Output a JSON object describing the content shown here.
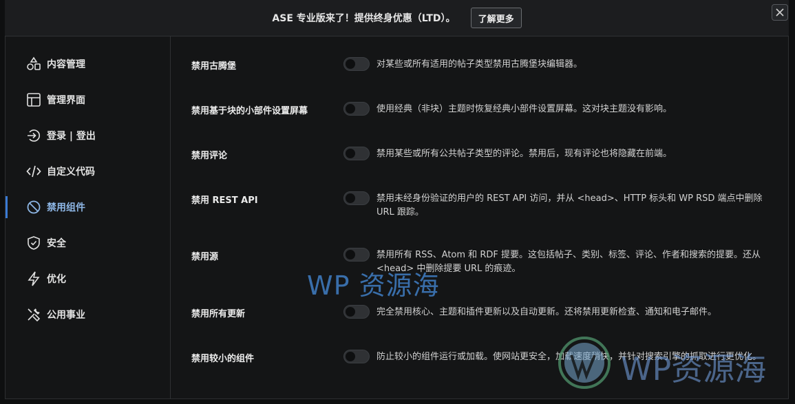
{
  "banner": {
    "text": "ASE 专业版来了！提供终身优惠（LTD）。",
    "button": "了解更多"
  },
  "close_icon": "close-icon",
  "sidebar": {
    "items": [
      {
        "label": "内容管理",
        "icon": "shapes-icon"
      },
      {
        "label": "管理界面",
        "icon": "layout-icon"
      },
      {
        "label": "登录 | 登出",
        "icon": "login-icon"
      },
      {
        "label": "自定义代码",
        "icon": "code-icon"
      },
      {
        "label": "禁用组件",
        "icon": "ban-icon",
        "active": true
      },
      {
        "label": "安全",
        "icon": "shield-icon"
      },
      {
        "label": "优化",
        "icon": "bolt-icon"
      },
      {
        "label": "公用事业",
        "icon": "tools-icon"
      }
    ]
  },
  "settings": [
    {
      "title": "禁用古腾堡",
      "enabled": false,
      "desc": "对某些或所有适用的帖子类型禁用古腾堡块编辑器。"
    },
    {
      "title": "禁用基于块的小部件设置屏幕",
      "enabled": false,
      "desc": "使用经典（非块）主题时恢复经典小部件设置屏幕。这对块主题没有影响。"
    },
    {
      "title": "禁用评论",
      "enabled": false,
      "desc": "禁用某些或所有公共帖子类型的评论。禁用后，现有评论也将隐藏在前端。"
    },
    {
      "title": "禁用 REST API",
      "enabled": false,
      "desc": "禁用未经身份验证的用户的 REST API 访问，并从 <head>、HTTP 标头和 WP RSD 端点中删除 URL 跟踪。"
    },
    {
      "title": "禁用源",
      "enabled": false,
      "desc": "禁用所有 RSS、Atom 和 RDF 提要。这包括帖子、类别、标签、评论、作者和搜索的提要。还从 <head> 中删除提要 URL 的痕迹。"
    },
    {
      "title": "禁用所有更新",
      "enabled": false,
      "desc": "完全禁用核心、主题和插件更新以及自动更新。还将禁用更新检查、通知和电子邮件。"
    },
    {
      "title": "禁用较小的组件",
      "enabled": false,
      "desc": "防止较小的组件运行或加载。使网站更安全，加载速度稍快，并针对搜索引擎的抓取进行更优化。"
    }
  ],
  "watermarks": {
    "center": "WP 资源海",
    "corner": "WP资源海"
  },
  "colors": {
    "accent": "#3a7bd5",
    "active_text": "#8eb7e6",
    "background": "#141516"
  }
}
